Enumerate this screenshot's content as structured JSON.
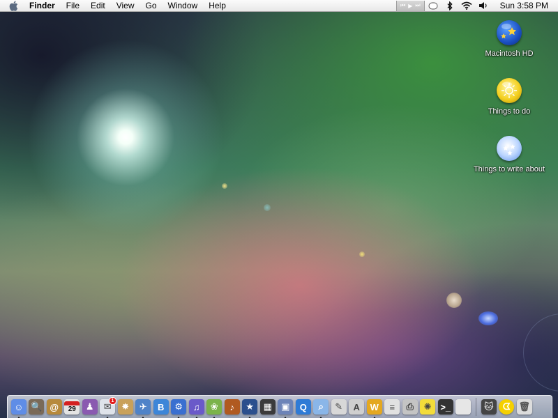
{
  "menubar": {
    "app_name": "Finder",
    "items": [
      "File",
      "Edit",
      "View",
      "Go",
      "Window",
      "Help"
    ],
    "clock": "Sun 3:58 PM",
    "itunes_controls": [
      "⏮",
      "▶",
      "⏭"
    ],
    "status_icons": [
      "sync-icon",
      "bluetooth-icon",
      "wifi-icon",
      "volume-icon"
    ]
  },
  "desktop": {
    "icons": [
      {
        "label": "Macintosh HD",
        "icon": "hard-drive-icon"
      },
      {
        "label": "Things to do",
        "icon": "folder-orb-yellow-icon"
      },
      {
        "label": "Things to write about",
        "icon": "folder-orb-blue-icon"
      }
    ]
  },
  "dock": {
    "calendar_day": "29",
    "mail_badge": "1",
    "blog_letter": "B",
    "apps": [
      {
        "name": "finder",
        "color": "#5f8de6",
        "glyph": "☺",
        "running": true
      },
      {
        "name": "spotlight-detective",
        "color": "#7a6a58",
        "glyph": "🔍",
        "running": false
      },
      {
        "name": "address-book",
        "color": "#b78a3c",
        "glyph": "@",
        "running": false
      },
      {
        "name": "ical",
        "color": "#e4e4e4",
        "glyph": "",
        "running": false
      },
      {
        "name": "ichat",
        "color": "#8a5ab0",
        "glyph": "♟",
        "running": false
      },
      {
        "name": "mail",
        "color": "#dfe3ea",
        "glyph": "✉",
        "running": true
      },
      {
        "name": "safari",
        "color": "#c9a15a",
        "glyph": "✸",
        "running": false
      },
      {
        "name": "compass-app",
        "color": "#4f83c8",
        "glyph": "✈",
        "running": true
      },
      {
        "name": "blog-app",
        "color": "#3d86d8",
        "glyph": "",
        "running": false
      },
      {
        "name": "network-app",
        "color": "#3a6fd0",
        "glyph": "⚙",
        "running": true
      },
      {
        "name": "itunes",
        "color": "#6a5ac9",
        "glyph": "♫",
        "running": true
      },
      {
        "name": "iphoto",
        "color": "#7bb34a",
        "glyph": "❀",
        "running": true
      },
      {
        "name": "garageband",
        "color": "#b05a20",
        "glyph": "♪",
        "running": false
      },
      {
        "name": "imovie",
        "color": "#2b4f8d",
        "glyph": "★",
        "running": true
      },
      {
        "name": "photo-booth",
        "color": "#3b3b3b",
        "glyph": "▦",
        "running": false
      },
      {
        "name": "preview",
        "color": "#6d84b8",
        "glyph": "▣",
        "running": true
      },
      {
        "name": "quicktime",
        "color": "#2f7bd6",
        "glyph": "Q",
        "running": false
      },
      {
        "name": "magnifier-app",
        "color": "#8ab6e8",
        "glyph": "⌕",
        "running": true
      },
      {
        "name": "textedit",
        "color": "#d8d8d8",
        "glyph": "✎",
        "running": false
      },
      {
        "name": "script-editor",
        "color": "#cfcfcf",
        "glyph": "A",
        "running": false
      },
      {
        "name": "web-editor",
        "color": "#e4a820",
        "glyph": "W",
        "running": true
      },
      {
        "name": "pages",
        "color": "#e1e1e1",
        "glyph": "≡",
        "running": false
      },
      {
        "name": "printer-app",
        "color": "#c4c4c4",
        "glyph": "⎙",
        "running": false
      },
      {
        "name": "stickies",
        "color": "#f3dc3a",
        "glyph": "✺",
        "running": false
      },
      {
        "name": "terminal",
        "color": "#333333",
        "glyph": ">_",
        "running": false
      },
      {
        "name": "about-mac",
        "color": "#e6e6e6",
        "glyph": "",
        "running": false
      }
    ],
    "right_items": [
      {
        "name": "cat-app",
        "color": "#444444",
        "glyph": "🐱"
      },
      {
        "name": "pacman-app",
        "color": "#f5d000",
        "glyph": "ᗧ"
      },
      {
        "name": "trash",
        "color": "#dcdcdc",
        "glyph": "🗑"
      }
    ]
  },
  "colors": {
    "menubar_bg": "#f2f2f2",
    "label_text": "#ffffff",
    "badge_red": "#e21b1b"
  }
}
